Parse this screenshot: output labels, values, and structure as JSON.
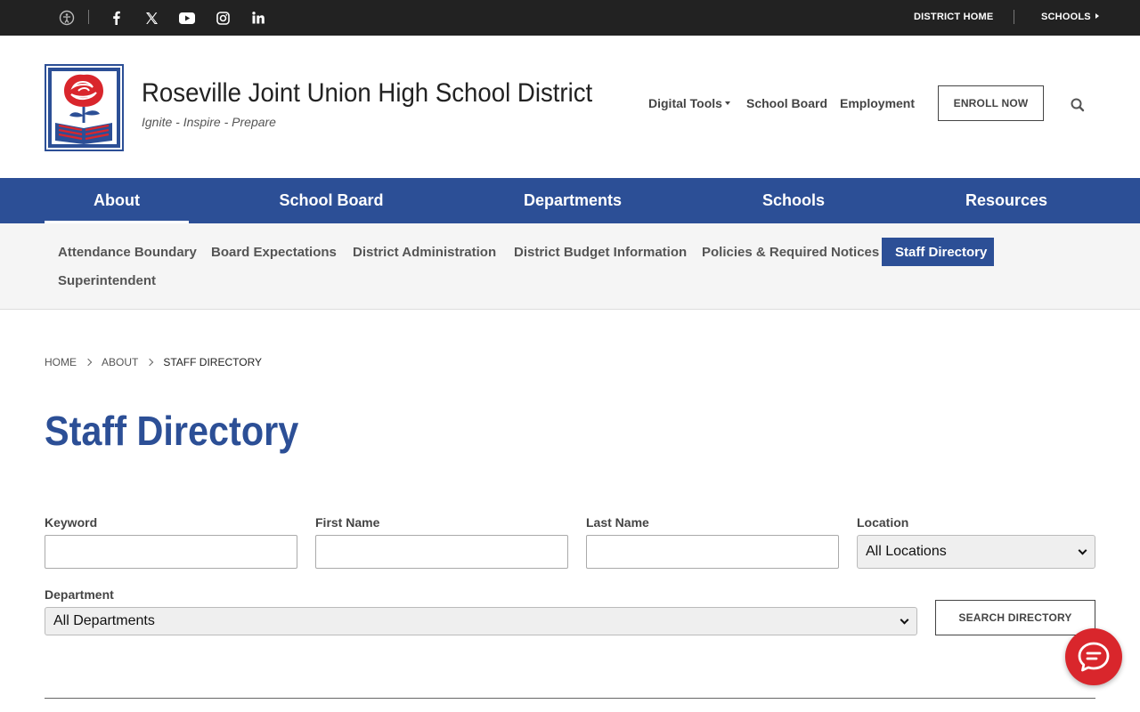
{
  "topbar": {
    "icons": [
      "accessibility-icon",
      "facebook-icon",
      "x-twitter-icon",
      "youtube-icon",
      "instagram-icon",
      "linkedin-icon"
    ],
    "district_home": "DISTRICT HOME",
    "schools": "SCHOOLS"
  },
  "header": {
    "title": "Roseville Joint Union High School District",
    "tagline": "Ignite - Inspire - Prepare",
    "links": {
      "digital_tools": "Digital Tools",
      "school_board": "School Board",
      "employment": "Employment"
    },
    "enroll": "ENROLL NOW"
  },
  "main_nav": {
    "items": [
      "About",
      "School Board",
      "Departments",
      "Schools",
      "Resources"
    ],
    "active": "About"
  },
  "sub_nav": {
    "items": [
      "Attendance Boundary",
      "Board Expectations",
      "District Administration",
      "District Budget Information",
      "Policies & Required Notices",
      "Staff Directory",
      "Superintendent"
    ],
    "active": "Staff Directory"
  },
  "breadcrumb": [
    "HOME",
    "ABOUT",
    "STAFF DIRECTORY"
  ],
  "page_title": "Staff Directory",
  "form": {
    "keyword_label": "Keyword",
    "keyword_value": "",
    "first_name_label": "First Name",
    "first_name_value": "",
    "last_name_label": "Last Name",
    "last_name_value": "",
    "location_label": "Location",
    "location_selected": "All Locations",
    "department_label": "Department",
    "department_selected": "All Departments",
    "search_button": "SEARCH DIRECTORY"
  },
  "colors": {
    "brand_blue": "#2c4f96",
    "topbar": "#222222",
    "chat_red": "#d9262c"
  },
  "chat_icon": "chat-bubble-icon"
}
